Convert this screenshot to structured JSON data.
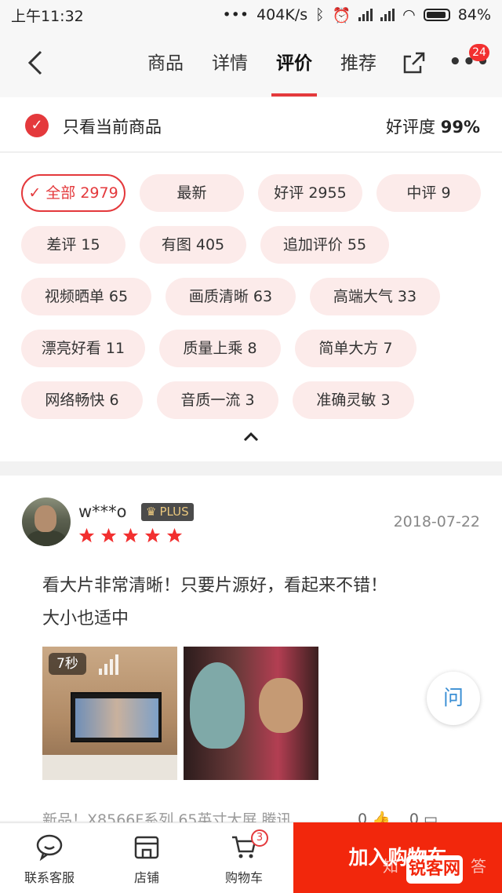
{
  "status": {
    "time": "上午11:32",
    "dots": "•••",
    "speed": "404K/s",
    "battery": "84%"
  },
  "nav": {
    "tabs": [
      "商品",
      "详情",
      "评价",
      "推荐"
    ],
    "active_tab": "评价",
    "more_badge": "24"
  },
  "filter": {
    "only_current_label": "只看当前商品",
    "rating_label": "好评度",
    "rating_value": "99%"
  },
  "tags": [
    {
      "label": "全部 2979",
      "active": true
    },
    {
      "label": "最新"
    },
    {
      "label": "好评 2955"
    },
    {
      "label": "中评 9"
    },
    {
      "label": "差评 15"
    },
    {
      "label": "有图 405"
    },
    {
      "label": "追加评价 55"
    },
    {
      "label": "视频晒单 65"
    },
    {
      "label": "画质清晰 63"
    },
    {
      "label": "高端大气 33"
    },
    {
      "label": "漂亮好看 11"
    },
    {
      "label": "质量上乘 8"
    },
    {
      "label": "简单大方 7"
    },
    {
      "label": "网络畅快 6"
    },
    {
      "label": "音质一流 3"
    },
    {
      "label": "准确灵敏 3"
    }
  ],
  "review": {
    "username": "w***o",
    "plus_label": "PLUS",
    "rating": 5,
    "date": "2018-07-22",
    "content": "看大片非常清晰！只要片源好，看起来不错！大小也适中",
    "video_duration": "7秒",
    "meta": "新品！X8566F系列 65英寸大屏 腾讯",
    "float_button": "问",
    "like_count": "0",
    "comment_count": "0"
  },
  "bottom": {
    "service_label": "联系客服",
    "shop_label": "店铺",
    "cart_label": "购物车",
    "cart_badge": "3",
    "add_cart_label": "加入购物车",
    "watermark_text": "知",
    "watermark_logo": "锐客网",
    "watermark_tail": "答"
  },
  "colors": {
    "accent": "#e4393c",
    "cta": "#f2270c",
    "tag_bg": "#fcebea",
    "star": "#f23030"
  }
}
